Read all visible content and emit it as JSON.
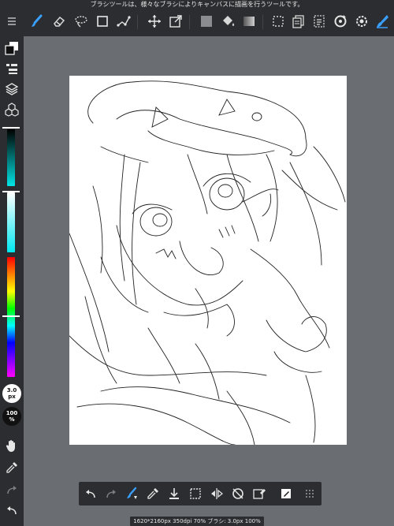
{
  "tooltip": "ブラシツールは、様々なブラシによりキャンバスに描画を行うツールです。",
  "icons": {
    "menu": "menu-icon",
    "brush": "brush-icon",
    "eraser": "eraser-icon",
    "lasso": "lasso-icon",
    "rectangle": "rectangle-icon",
    "curve": "curve-icon",
    "move": "move-icon",
    "transform": "transform-icon",
    "fill_color": "fill-color-icon",
    "bucket": "bucket-icon",
    "gradient": "gradient-icon",
    "select": "select-icon",
    "copy_layer": "copy-layer-icon",
    "paste": "paste-icon",
    "rotate": "rotate-icon",
    "settings": "settings-icon",
    "pen_active": "pen-active-icon"
  },
  "colors": {
    "accent": "#3aa0ff",
    "toolbar_bg": "#2b2d30",
    "workspace_bg": "#6a6d72",
    "canvas_bg": "#ffffff"
  },
  "sidebar": {
    "brush_size_value": "3.0",
    "brush_size_unit": "px",
    "opacity_value": "100",
    "opacity_unit": "%"
  },
  "status": {
    "text": "1620*2160px 350dpi 70% ブラシ: 3.0px 100%"
  }
}
